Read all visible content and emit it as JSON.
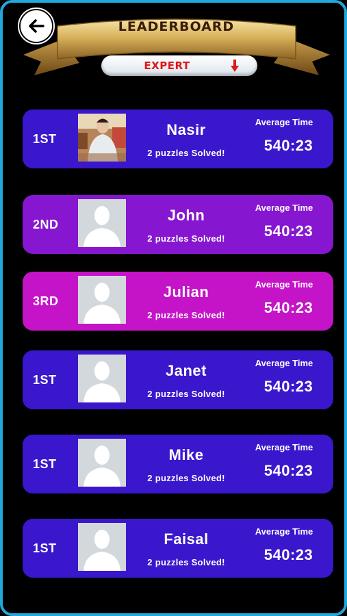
{
  "header": {
    "title": "LEADERBOARD",
    "level": "EXPERT",
    "icons": {
      "back": "arrow-left-icon",
      "dropdown": "arrow-down-icon"
    },
    "colors": {
      "banner_gold": "#d8b25c",
      "accent_red": "#e01818",
      "frame_blue": "#1fa9de"
    }
  },
  "entries": [
    {
      "rank": "1ST",
      "name": "Nasir",
      "solved": "2 puzzles Solved!",
      "avg_label": "Average Time",
      "avg_time": "540:23",
      "avatar": "photo",
      "color": "#3a17cd"
    },
    {
      "rank": "2ND",
      "name": "John",
      "solved": "2 puzzles Solved!",
      "avg_label": "Average Time",
      "avg_time": "540:23",
      "avatar": "placeholder",
      "color": "#8616d0"
    },
    {
      "rank": "3RD",
      "name": "Julian",
      "solved": "2 puzzles Solved!",
      "avg_label": "Average Time",
      "avg_time": "540:23",
      "avatar": "placeholder",
      "color": "#c513c8"
    },
    {
      "rank": "1ST",
      "name": "Janet",
      "solved": "2 puzzles Solved!",
      "avg_label": "Average Time",
      "avg_time": "540:23",
      "avatar": "placeholder",
      "color": "#3a17cd"
    },
    {
      "rank": "1ST",
      "name": "Mike",
      "solved": "2 puzzles Solved!",
      "avg_label": "Average Time",
      "avg_time": "540:23",
      "avatar": "placeholder",
      "color": "#3a17cd"
    },
    {
      "rank": "1ST",
      "name": "Faisal",
      "solved": "2 puzzles Solved!",
      "avg_label": "Average Time",
      "avg_time": "540:23",
      "avatar": "placeholder",
      "color": "#3a17cd"
    }
  ]
}
